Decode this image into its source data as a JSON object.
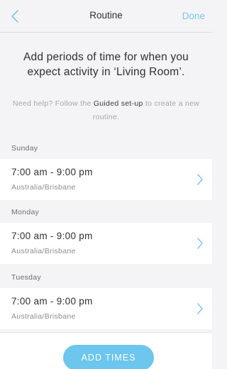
{
  "header": {
    "title": "Routine",
    "done_label": "Done",
    "back_icon": "chevron-left-icon",
    "accent_color": "#7fc6ea"
  },
  "intro": {
    "text": "Add periods of time for when you expect activity in ‘Living Room’."
  },
  "help": {
    "prefix": "Need help? Follow the ",
    "link_label": "Guided set-up",
    "suffix": " to create a new routine."
  },
  "routines": [
    {
      "day": "Sunday",
      "time": "7:00 am - 9:00 pm",
      "timezone": "Australia/Brisbane"
    },
    {
      "day": "Monday",
      "time": "7:00 am - 9:00 pm",
      "timezone": "Australia/Brisbane"
    },
    {
      "day": "Tuesday",
      "time": "7:00 am - 9:00 pm",
      "timezone": "Australia/Brisbane"
    }
  ],
  "footer": {
    "add_times_label": "ADD TIMES",
    "button_color": "#6cc6ee"
  }
}
